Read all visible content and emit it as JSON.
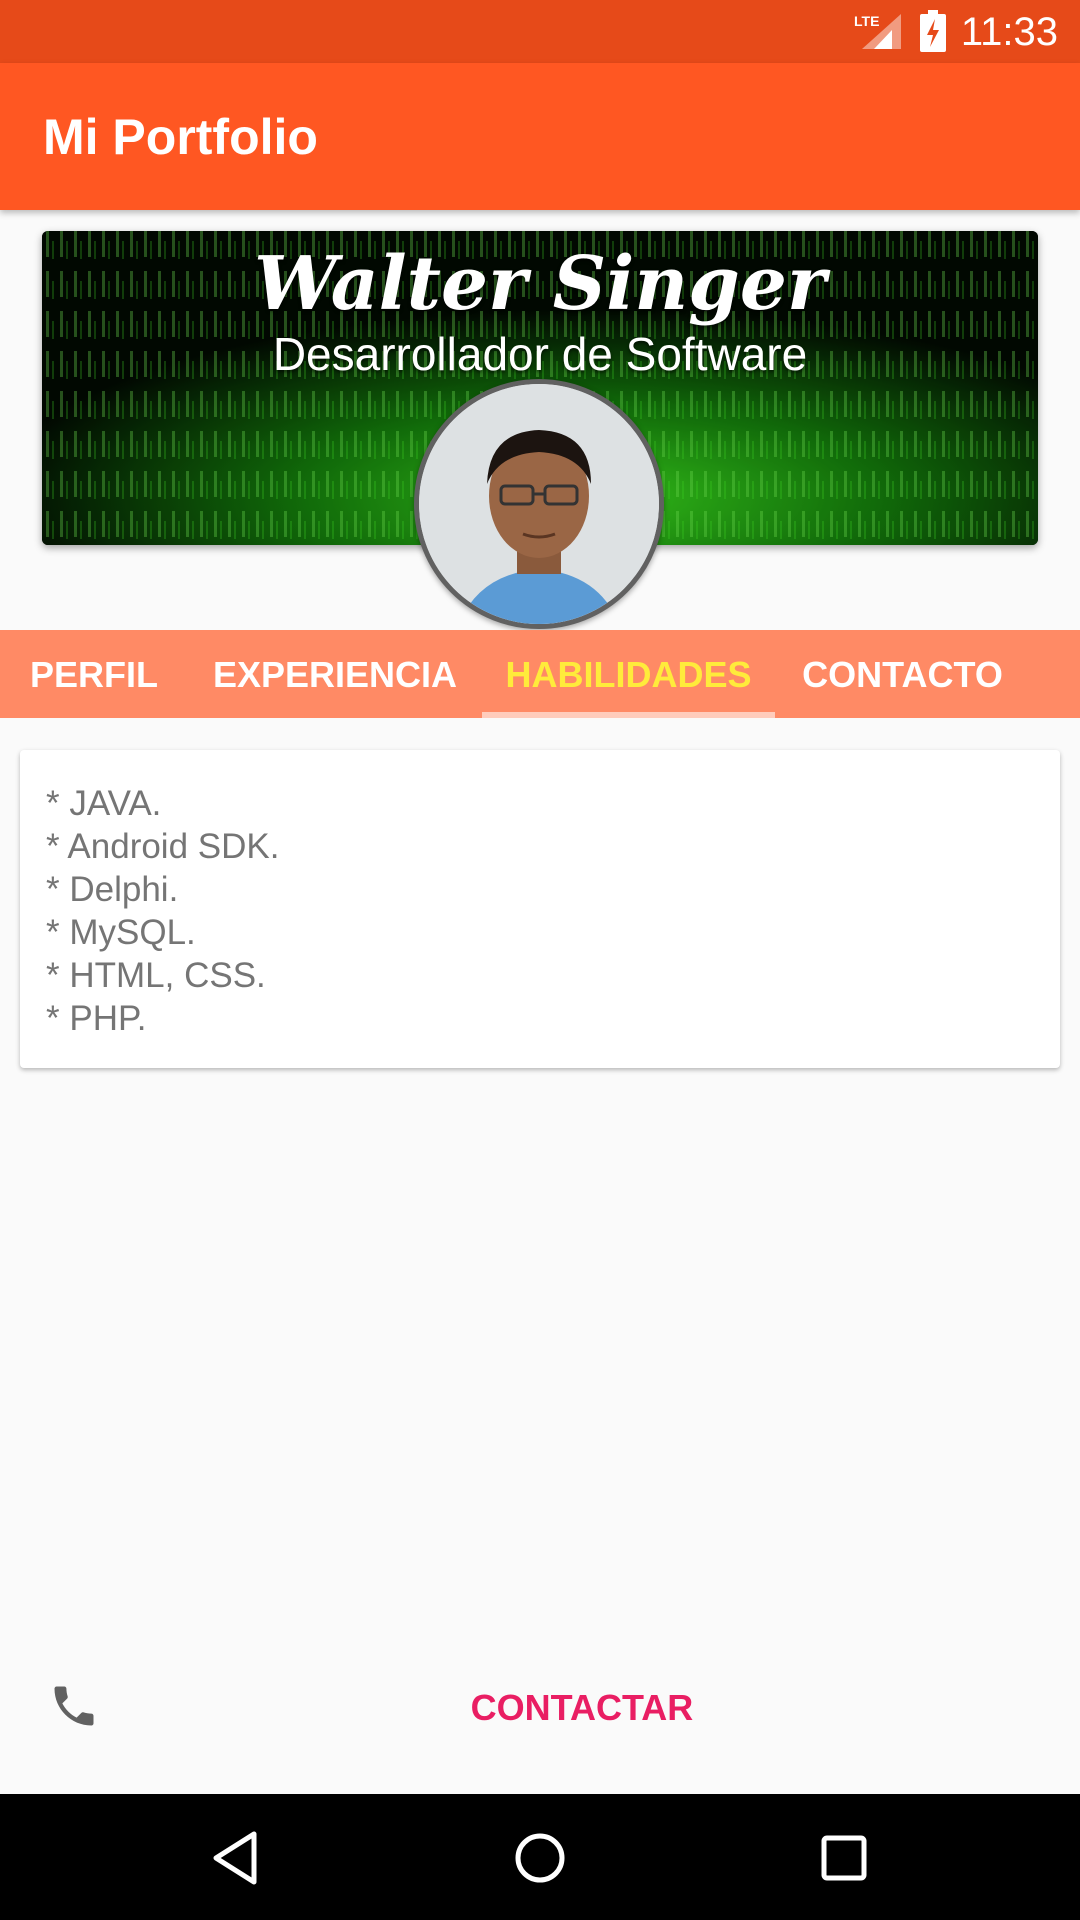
{
  "status_bar": {
    "time": "11:33",
    "network_label": "LTE",
    "icons": [
      "lte-signal-icon",
      "battery-charging-icon"
    ]
  },
  "app_bar": {
    "title": "Mi Portfolio"
  },
  "header": {
    "name": "Walter Singer",
    "role": "Desarrollador de Software"
  },
  "tabs": [
    {
      "label": "PERFIL",
      "active": false
    },
    {
      "label": "EXPERIENCIA",
      "active": false
    },
    {
      "label": "HABILIDADES",
      "active": true
    },
    {
      "label": "CONTACTO",
      "active": false
    }
  ],
  "skills": [
    "* JAVA.",
    "* Android SDK.",
    "* Delphi.",
    "* MySQL.",
    "* HTML, CSS.",
    "* PHP."
  ],
  "action": {
    "icon": "phone-icon",
    "label": "CONTACTAR"
  },
  "nav": {
    "icons": [
      "back-icon",
      "home-icon",
      "recents-icon"
    ]
  },
  "colors": {
    "status_bar": "#e64a19",
    "primary": "#ff5722",
    "tab_bar": "#ff8a65",
    "tab_active": "#ffeb3b",
    "accent": "#e91e63",
    "body_text": "#757575"
  }
}
